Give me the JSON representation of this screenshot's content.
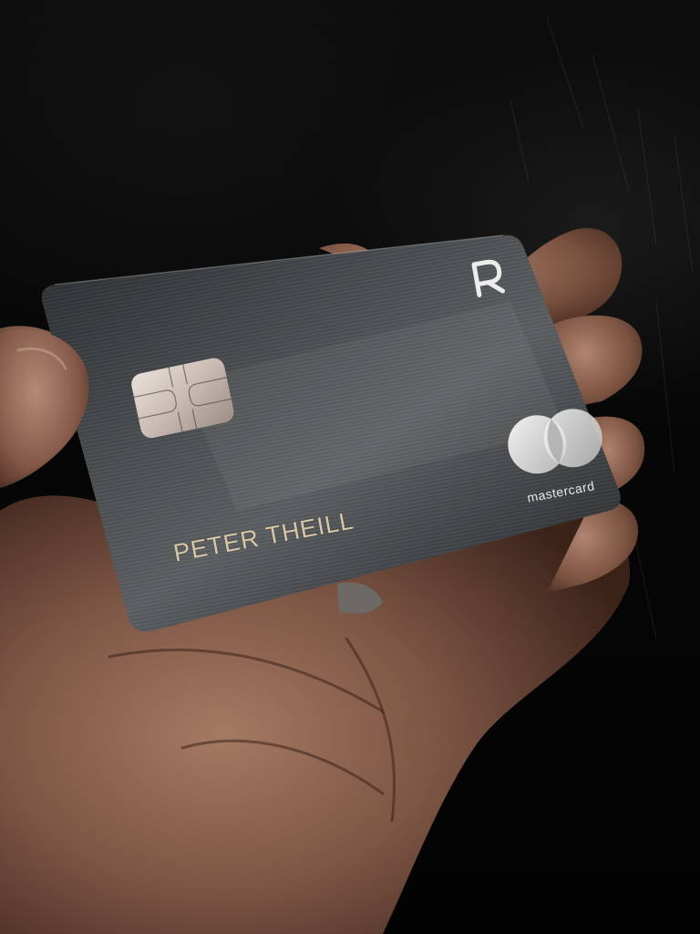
{
  "card": {
    "cardholder_name": "PETER THEILL",
    "network_wordmark": "mastercard",
    "issuer_logo_icon": "revolut-r-icon",
    "chip_icon": "emv-chip-icon",
    "network_logo_icon": "mastercard-circles-icon",
    "finish_color": "#3a3d3f",
    "text_color": "#d9c8a8"
  }
}
